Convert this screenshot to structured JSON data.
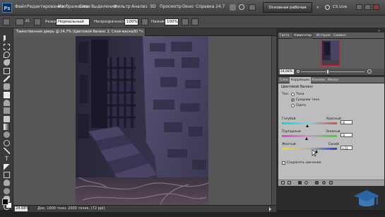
{
  "menubar": {
    "logo": "Ps",
    "items": [
      "Файл",
      "Редактирование",
      "Изображение",
      "Слои",
      "Выделение",
      "Фильтр",
      "Анализ",
      "3D",
      "Просмотр",
      "Окно",
      "Справка"
    ],
    "zoom": "24.7",
    "workspace_label": "Основная рабочая среда",
    "cs_live": "CS Live"
  },
  "options": {
    "mode_label": "Режим:",
    "mode_value": "Нормальный",
    "opacity_label": "Непрозрачность:",
    "opacity_value": "100%",
    "pressure_label": "Нажим:",
    "pressure_value": "100%",
    "brush_size": "45"
  },
  "document": {
    "tab_title": "Таинственная дверь @ 24,7% (Цветовой баланс 2, Слой-маска/8) *",
    "zoom": "24,68%",
    "status": "Док: 1600 тонн. 2000 точек, (72 ppi)"
  },
  "navigator": {
    "tabs": [
      "Гисто",
      "Навигатор",
      "История",
      "Символ"
    ],
    "zoom": "24,68%"
  },
  "adjustments": {
    "tabs": [
      "Слои",
      "Коррекция",
      "Каналы",
      "Маски"
    ],
    "title": "Цветовой баланс",
    "tone_label": "Тон:",
    "tones": [
      "Тени",
      "Средние тона",
      "Света"
    ],
    "selected_tone": "Средние тона",
    "sliders": [
      {
        "left": "Голубой",
        "right": "Красный",
        "value": "-6",
        "position": 0.46
      },
      {
        "left": "Пурпурный",
        "right": "Зеленый",
        "value": "-9",
        "position": 0.45
      },
      {
        "left": "Желтый",
        "right": "Синий",
        "value": "+31",
        "position": 0.63
      }
    ],
    "preserve_label": "Сохранять свечение",
    "preserve_checked": true
  },
  "colors": {
    "accent_red": "#c21f2d",
    "panel_bg": "#bdbdbd",
    "photo_tint": "#2b2d4a"
  }
}
